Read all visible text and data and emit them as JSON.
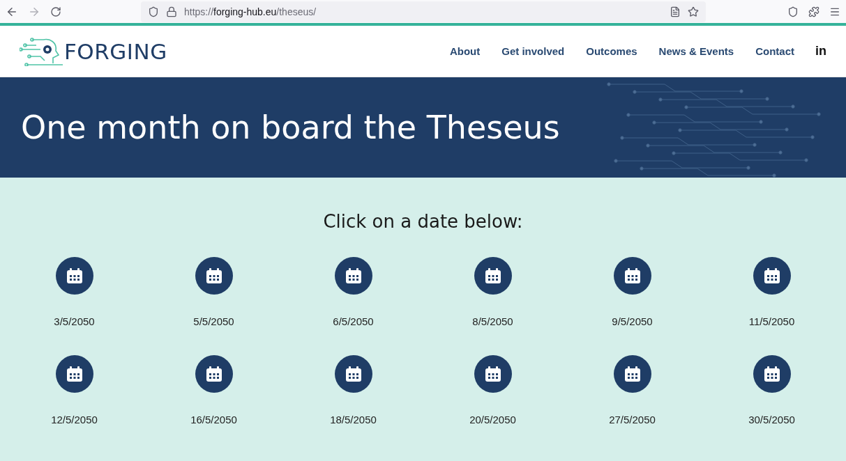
{
  "browser": {
    "url_prefix": "https://",
    "url_host": "forging-hub.eu",
    "url_path": "/theseus/"
  },
  "logo": {
    "text": "FORGING"
  },
  "nav": [
    {
      "label": "About"
    },
    {
      "label": "Get involved"
    },
    {
      "label": "Outcomes"
    },
    {
      "label": "News & Events"
    },
    {
      "label": "Contact"
    },
    {
      "label": "in",
      "kind": "social"
    }
  ],
  "banner": {
    "title": "One month on board the Theseus"
  },
  "heading": "Click on a date below:",
  "dates": [
    "3/5/2050",
    "5/5/2050",
    "6/5/2050",
    "8/5/2050",
    "9/5/2050",
    "11/5/2050",
    "12/5/2050",
    "16/5/2050",
    "18/5/2050",
    "20/5/2050",
    "27/5/2050",
    "30/5/2050"
  ]
}
